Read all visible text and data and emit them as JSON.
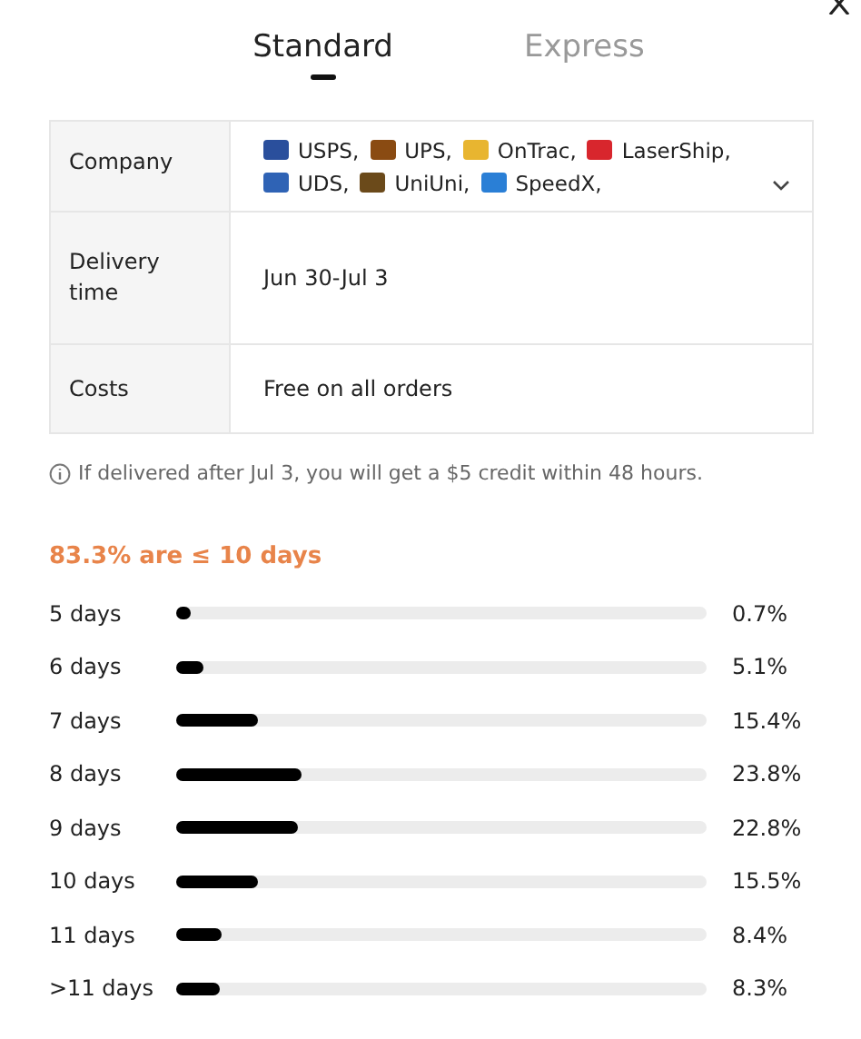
{
  "tabs": [
    {
      "label": "Standard",
      "selected": true
    },
    {
      "label": "Express",
      "selected": false
    }
  ],
  "details": {
    "rows": [
      {
        "label": "Company",
        "kind": "carriers",
        "carriers": [
          {
            "name": "USPS,",
            "color": "#2a4f9c"
          },
          {
            "name": "UPS,",
            "color": "#8a4b12"
          },
          {
            "name": "OnTrac,",
            "color": "#e8b530"
          },
          {
            "name": "LaserShip,",
            "color": "#d8262d"
          },
          {
            "name": "UDS,",
            "color": "#2f63b5"
          },
          {
            "name": "UniUni,",
            "color": "#6b4a1a"
          },
          {
            "name": "SpeedX,",
            "color": "#2a7fd6"
          }
        ],
        "expanded": false
      },
      {
        "label": "Delivery time",
        "kind": "text",
        "value": "Jun 30-Jul 3"
      },
      {
        "label": "Costs",
        "kind": "text",
        "value": "Free on all orders"
      }
    ]
  },
  "note": "If delivered after Jul 3, you will get a $5 credit within 48 hours.",
  "distribution": {
    "headline": "83.3% are ≤ 10 days",
    "rows": [
      {
        "label": "5 days",
        "level": 0.007,
        "reading": "0.7%"
      },
      {
        "label": "6 days",
        "level": 0.051,
        "reading": "5.1%"
      },
      {
        "label": "7 days",
        "level": 0.154,
        "reading": "15.4%"
      },
      {
        "label": "8 days",
        "level": 0.238,
        "reading": "23.8%"
      },
      {
        "label": "9 days",
        "level": 0.228,
        "reading": "22.8%"
      },
      {
        "label": "10 days",
        "level": 0.155,
        "reading": "15.5%"
      },
      {
        "label": "11 days",
        "level": 0.084,
        "reading": "8.4%"
      },
      {
        "label": ">11 days",
        "level": 0.083,
        "reading": "8.3%"
      }
    ]
  }
}
